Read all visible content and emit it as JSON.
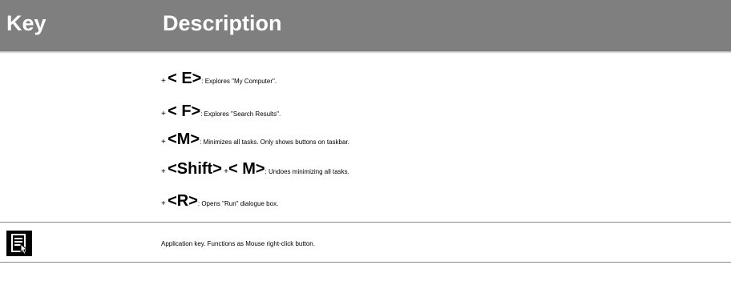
{
  "header": {
    "key_label": "Key",
    "description_label": "Description",
    "background_color": "#7f7f7f",
    "text_color": "#ffffff"
  },
  "windows_combos": [
    {
      "plus": "+",
      "key": "< E>",
      "desc": ": Explores \"My Computer\"."
    },
    {
      "plus": "+",
      "key": "< F>",
      "desc": ": Explores \"Search Results\"."
    },
    {
      "plus": "+",
      "key": "<M>",
      "desc": ": Minimizes all tasks. Only shows buttons on taskbar."
    },
    {
      "plus": "+",
      "key": " <Shift>",
      "plus2": "+",
      "key2": "< M>",
      "desc": ": Undoes minimizing all tasks."
    },
    {
      "plus": "+",
      "key": "<R>",
      "desc": ": Opens \"Run\" dialogue box."
    }
  ],
  "application_key": {
    "icon": "application-key-icon",
    "description": "Application key. Functions as Mouse right-click button."
  }
}
